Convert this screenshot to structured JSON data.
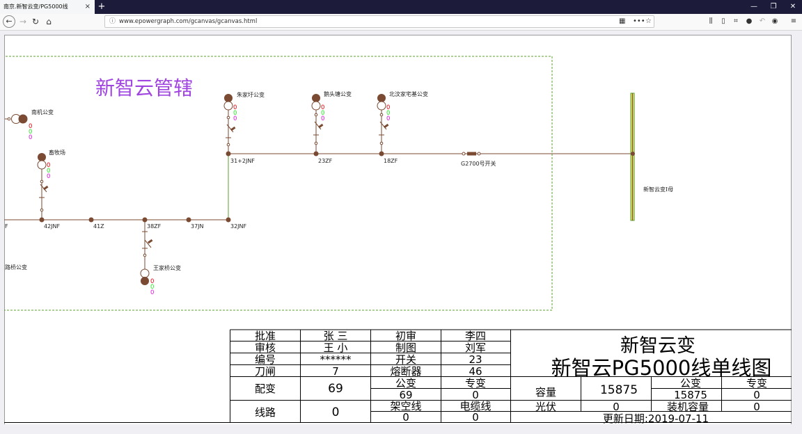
{
  "browser": {
    "tab_title": "南京.新智云变/PG5000线",
    "tab_close": "×",
    "new_tab": "+",
    "url": "www.epowergraph.com/gcanvas/gcanvas.html",
    "window_controls": {
      "minimize": "—",
      "restore": "❐",
      "close": "✕"
    }
  },
  "diagram": {
    "region_title": "新智云管辖",
    "busbar_label": "新智云变I母",
    "node_labels": [
      "F",
      "42JNF",
      "41Z",
      "38ZF",
      "37JN",
      "32JNF",
      "31+2JNF",
      "23ZF",
      "18ZF",
      "G2700号开关"
    ],
    "transformers": [
      {
        "name": "南机公变",
        "values": [
          "0",
          "0",
          "0"
        ]
      },
      {
        "name": "畜牧场",
        "values": [
          "0",
          "0",
          "0"
        ]
      },
      {
        "name": "王家桥公变",
        "values": [
          "0",
          "0",
          "0"
        ]
      },
      {
        "name": "朱家圩公变",
        "values": [
          "0",
          "0",
          "0"
        ]
      },
      {
        "name": "鹅头塘公变",
        "values": [
          "0",
          "0",
          "0"
        ]
      },
      {
        "name": "北汶家宅基公变",
        "values": [
          "0",
          "0",
          "0"
        ]
      }
    ],
    "cut_label": "路桥公变",
    "value_colors": [
      "#e8000b",
      "#22ee22",
      "#e010e0"
    ]
  },
  "titleblock": {
    "approve_label": "批准",
    "approve": "张 三",
    "review_label": "审核",
    "review": "王 小",
    "number_label": "编号",
    "number": "******",
    "knife_label": "刀闸",
    "knife": "7",
    "dist_label": "配变",
    "dist": "69",
    "line_label": "线路",
    "line": "0",
    "first_review_label": "初审",
    "first_review": "李四",
    "drawn_label": "制图",
    "drawn": "刘军",
    "switch_label": "开关",
    "switch": "23",
    "fuse_label": "熔断器",
    "fuse": "46",
    "public_label": "公变",
    "public": "69",
    "private_label": "专变",
    "private": "0",
    "overhead_label": "架空线",
    "overhead": "0",
    "cable_label": "电缆线",
    "cable": "0",
    "station": "新智云变",
    "drawing_title": "新智云PG5000线单线图",
    "capacity_label": "容量",
    "capacity": "15875",
    "cap_public_label": "公变",
    "cap_public": "15875",
    "cap_private_label": "专变",
    "cap_private": "0",
    "pv_label": "光伏",
    "pv": "0",
    "installed_label": "装机容量",
    "installed": "0",
    "update_date": "更新日期:2019-07-11"
  }
}
